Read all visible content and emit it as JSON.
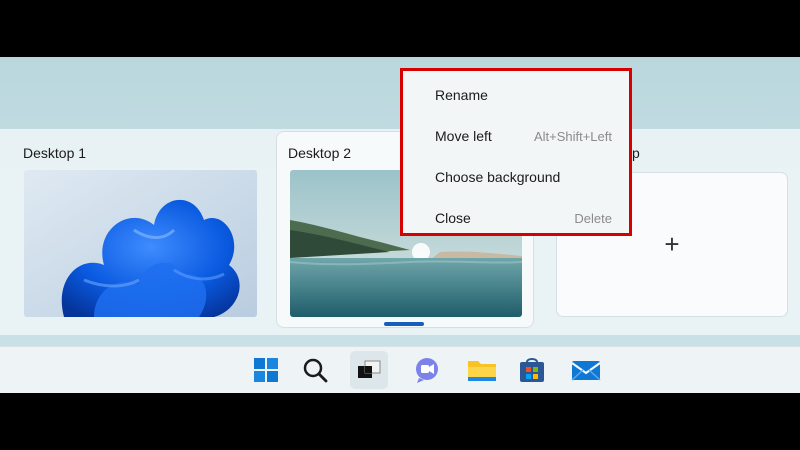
{
  "desktops": [
    {
      "label": "Desktop 1"
    },
    {
      "label": "Desktop 2"
    },
    {
      "label": "p"
    }
  ],
  "new_desktop": {
    "symbol": "+"
  },
  "context_menu": {
    "items": [
      {
        "label": "Rename",
        "shortcut": ""
      },
      {
        "label": "Move left",
        "shortcut": "Alt+Shift+Left"
      },
      {
        "label": "Choose background",
        "shortcut": ""
      },
      {
        "label": "Close",
        "shortcut": "Delete"
      }
    ],
    "highlight_color": "#d60000"
  },
  "taskbar": {
    "icons": [
      "windows-start-icon",
      "search-icon",
      "task-view-icon",
      "teams-chat-icon",
      "file-explorer-icon",
      "microsoft-store-icon",
      "mail-icon"
    ],
    "active": "task-view-icon"
  }
}
